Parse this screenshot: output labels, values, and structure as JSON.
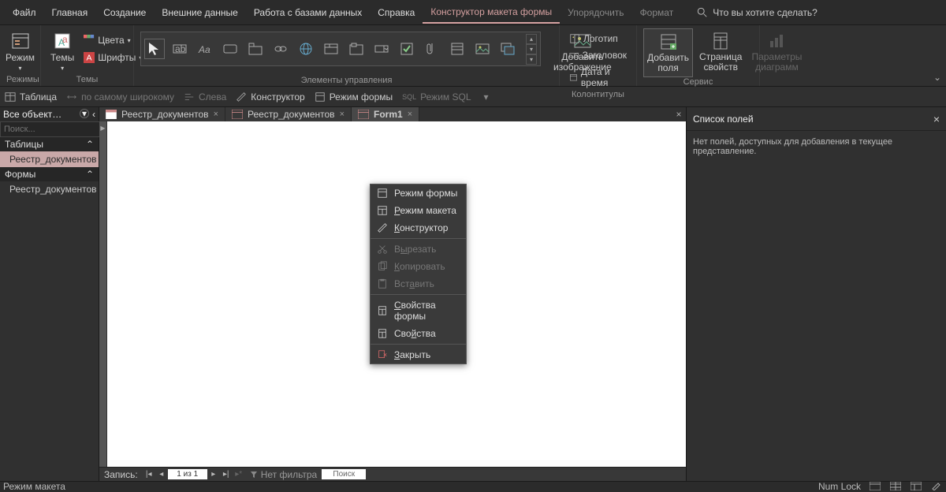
{
  "menu": {
    "file": "Файл",
    "home": "Главная",
    "create": "Создание",
    "external": "Внешние данные",
    "dbtools": "Работа с базами данных",
    "help": "Справка",
    "layout": "Конструктор макета формы",
    "arrange": "Упорядочить",
    "format": "Формат",
    "tellme": "Что вы хотите сделать?"
  },
  "ribbon": {
    "modes_group": "Режимы",
    "mode_btn": "Режим",
    "themes_group": "Темы",
    "themes_btn": "Темы",
    "colors": "Цвета",
    "fonts": "Шрифты",
    "controls_group": "Элементы управления",
    "add_image": "Добавить изображение",
    "headers_group": "Колонтитулы",
    "logo": "Логотип",
    "title": "Заголовок",
    "datetime": "Дата и время",
    "service_group": "Сервис",
    "add_fields": "Добавить поля",
    "prop_sheet": "Страница свойств",
    "chart_params": "Параметры диаграмм"
  },
  "subbar": {
    "table": "Таблица",
    "widest": "по самому широкому",
    "left": "Слева",
    "designer": "Конструктор",
    "form_view": "Режим формы",
    "sql_view": "Режим SQL"
  },
  "nav": {
    "title": "Все объект…",
    "search_ph": "Поиск...",
    "tables_hdr": "Таблицы",
    "forms_hdr": "Формы",
    "obj_name": "Реестр_документов"
  },
  "tabs": {
    "t1": "Реестр_документов",
    "t2": "Реестр_документов",
    "t3": "Form1"
  },
  "recnav": {
    "label": "Запись:",
    "counter": "1 из 1",
    "nofilter": "Нет фильтра",
    "search": "Поиск"
  },
  "fieldlist": {
    "title": "Список полей",
    "msg": "Нет полей, доступных для добавления в текущее представление."
  },
  "ctx": {
    "form_view": "Режим формы",
    "layout_view": "Режим макета",
    "design_view": "Конструктор",
    "cut": "Вырезать",
    "copy": "Копировать",
    "paste": "Вставить",
    "form_props": "Свойства формы",
    "props": "Свойства",
    "close": "Закрыть"
  },
  "status": {
    "mode": "Режим макета",
    "numlock": "Num Lock"
  }
}
